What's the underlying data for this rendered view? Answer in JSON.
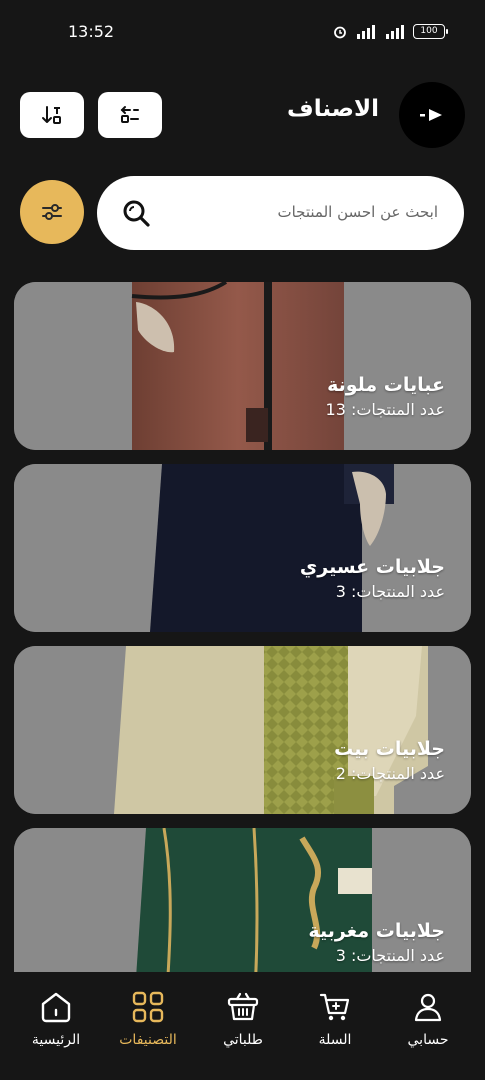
{
  "status": {
    "time": "13:52",
    "battery": "100"
  },
  "header": {
    "title": "الاصناف"
  },
  "search": {
    "placeholder": "ابحث عن احسن المنتجات"
  },
  "categories": [
    {
      "name": "عبايات ملونة",
      "count": "عدد المنتجات: 13"
    },
    {
      "name": "جلابيات عسيري",
      "count": "عدد المنتجات: 3"
    },
    {
      "name": "جلابيات بيت",
      "count": "عدد المنتجات: 2"
    },
    {
      "name": "جلابيات مغربية",
      "count": "عدد المنتجات: 3"
    }
  ],
  "nav": [
    {
      "label": "الرئيسية",
      "icon": "home-icon"
    },
    {
      "label": "التصنيفات",
      "icon": "categories-grid-icon",
      "active": true
    },
    {
      "label": "طلباتي",
      "icon": "basket-icon"
    },
    {
      "label": "السلة",
      "icon": "cart-icon"
    },
    {
      "label": "حسابي",
      "icon": "user-icon"
    }
  ],
  "colors": {
    "accent": "#e7b85b",
    "background": "#161616",
    "card": "#8b8b8b"
  }
}
